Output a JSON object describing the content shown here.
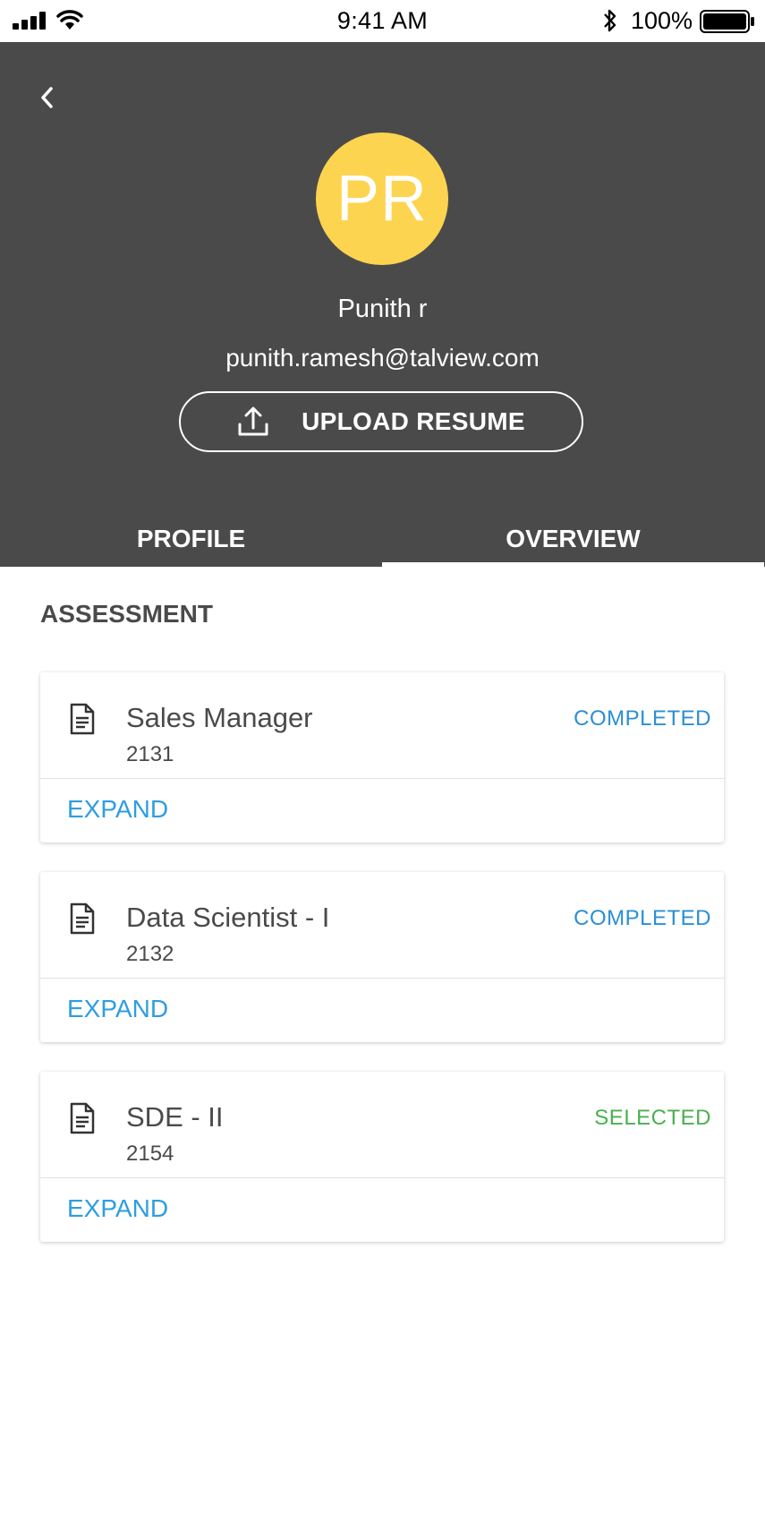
{
  "status_bar": {
    "time": "9:41 AM",
    "battery": "100%",
    "icons": [
      "signal-icon",
      "wifi-icon",
      "bluetooth-icon",
      "battery-icon"
    ]
  },
  "header": {
    "back_icon": "chevron-left-icon",
    "avatar_initials": "PR",
    "avatar_color": "#fdd44f",
    "name": "Punith r",
    "email": "punith.ramesh@talview.com",
    "upload_button": {
      "label": "UPLOAD RESUME",
      "icon": "upload-icon"
    },
    "background": "#4a4a4a"
  },
  "tabs": [
    {
      "label": "PROFILE",
      "active": false
    },
    {
      "label": "OVERVIEW",
      "active": true
    }
  ],
  "section": {
    "title": "ASSESSMENT"
  },
  "assessments": [
    {
      "title": "Sales Manager",
      "code": "2131",
      "status": "COMPLETED",
      "status_color": "#2b8fd3",
      "action": "EXPAND"
    },
    {
      "title": "Data Scientist - I",
      "code": "2132",
      "status": "COMPLETED",
      "status_color": "#2b8fd3",
      "action": "EXPAND"
    },
    {
      "title": "SDE - II",
      "code": "2154",
      "status": "SELECTED",
      "status_color": "#4caf50",
      "action": "EXPAND"
    }
  ],
  "colors": {
    "accent": "#2e9ee0"
  }
}
